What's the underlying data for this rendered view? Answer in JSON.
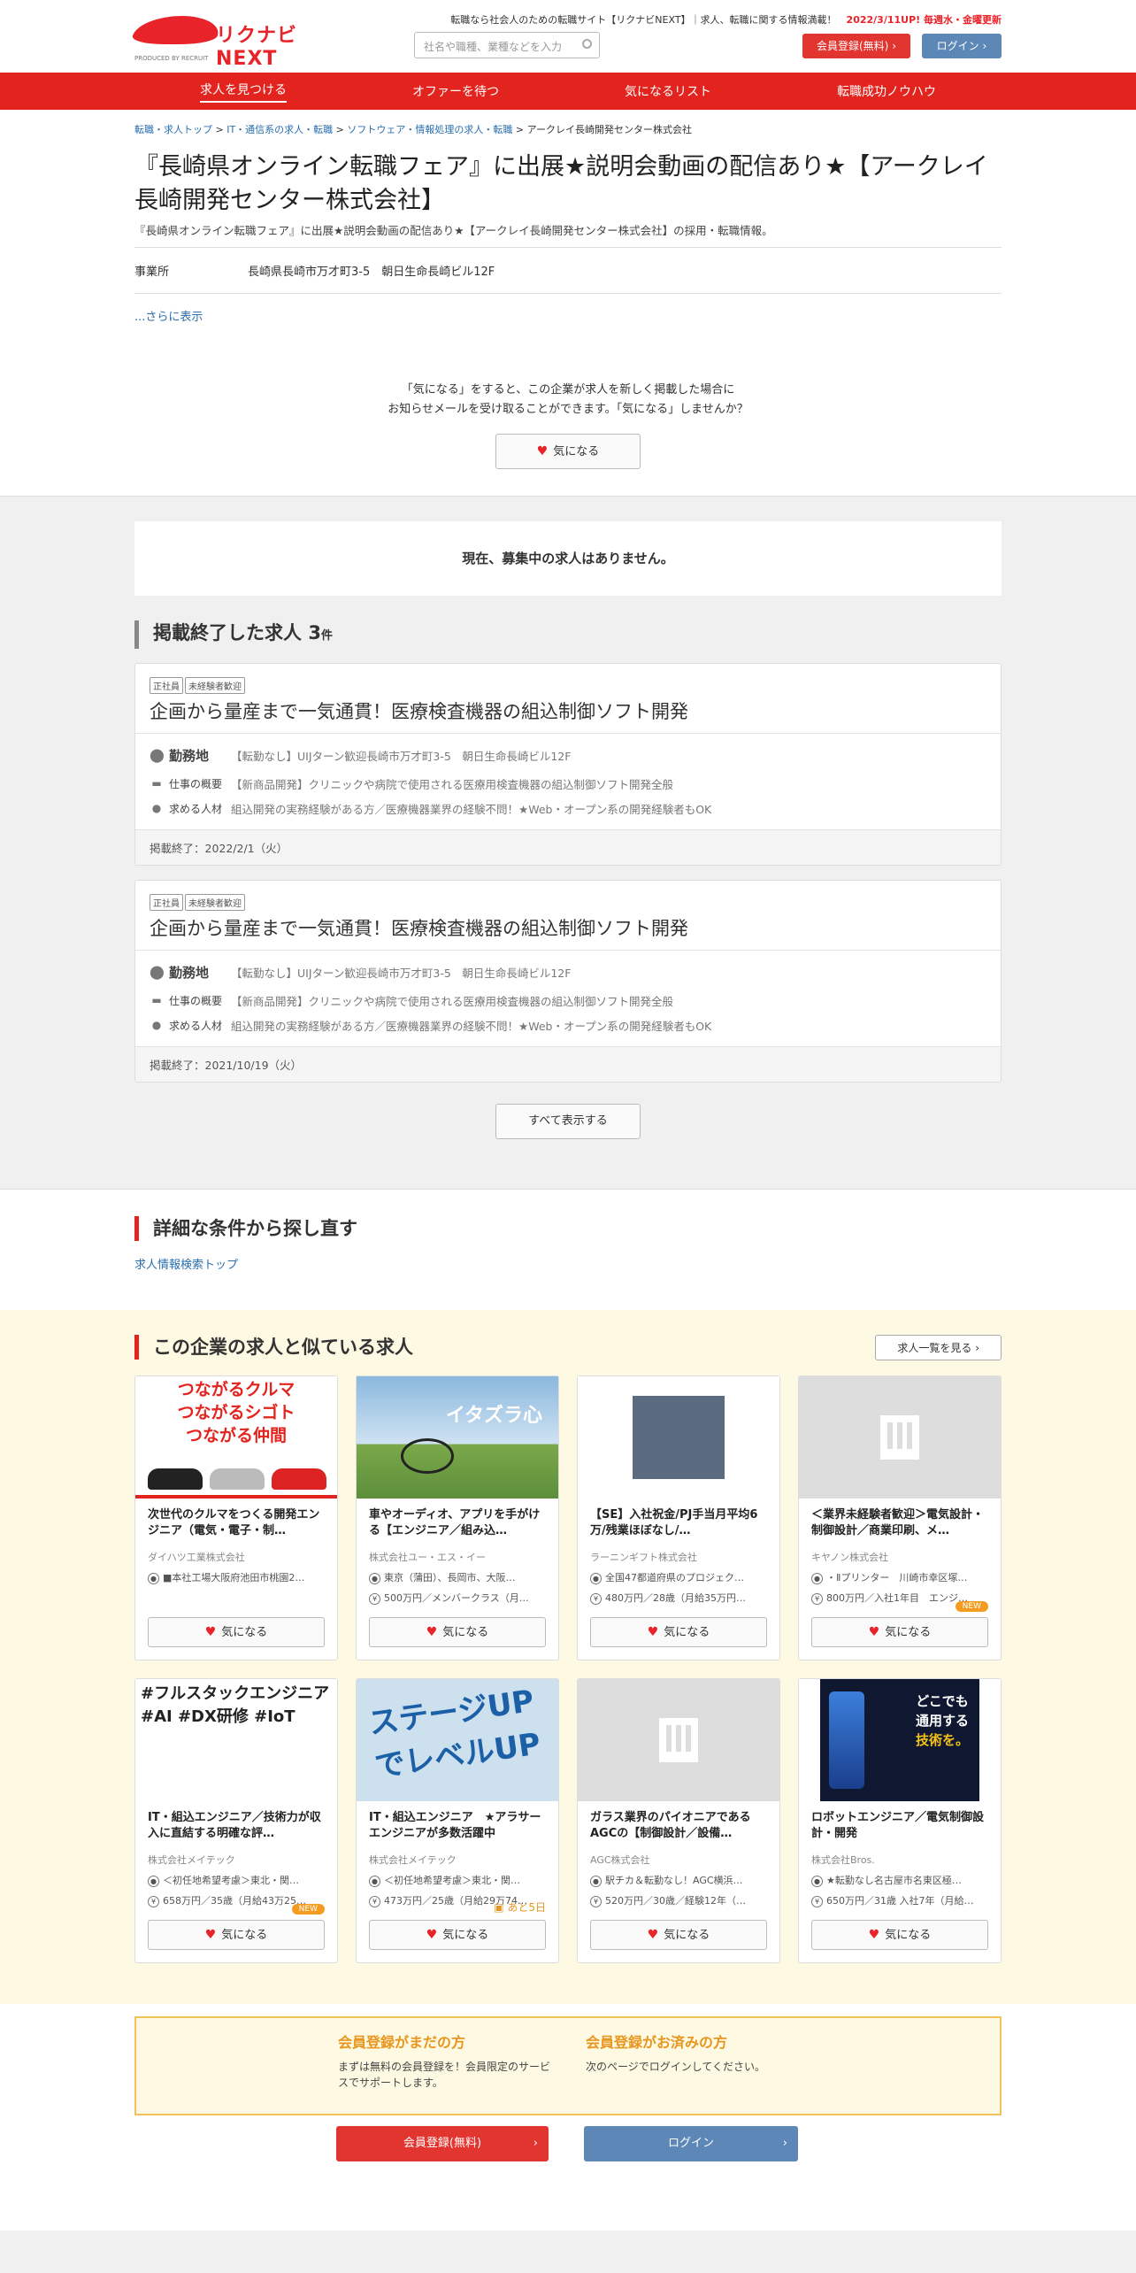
{
  "header": {
    "tagline_prefix": "転職なら社会人のための転職サイト【リクナビNEXT】｜求人、転職に関する情報満載！",
    "tagline_update": "2022/3/11UP! 毎週水・金曜更新",
    "logo_text": "リクナビNEXT",
    "logo_sub": "PRODUCED BY RECRUIT",
    "search_placeholder": "社名や職種、業種などを入力",
    "register_label": "会員登録(無料)",
    "login_label": "ログイン"
  },
  "nav": [
    "求人を見つける",
    "オファーを待つ",
    "気になるリスト",
    "転職成功ノウハウ"
  ],
  "breadcrumb": [
    "転職・求人トップ",
    "IT・通信系の求人・転職",
    "ソフトウェア・情報処理の求人・転職",
    "アークレイ長崎開発センター株式会社"
  ],
  "page": {
    "title": "『長崎県オンライン転職フェア』に出展★説明会動画の配信あり★【アークレイ長崎開発センター株式会社】",
    "description": "『長崎県オンライン転職フェア』に出展★説明会動画の配信あり★【アークレイ長崎開発センター株式会社】の採用・転職情報。",
    "office_label": "事業所",
    "office_value": "長崎県長崎市万才町3-5　朝日生命長崎ビル12F",
    "more": "...さらに表示",
    "fav_msg_1": "「気になる」をすると、この企業が求人を新しく掲載した場合に",
    "fav_msg_2": "お知らせメールを受け取ることができます。「気になる」しませんか？",
    "fav_button": "気になる"
  },
  "jobs": {
    "none_msg": "現在、募集中の求人はありません。",
    "ended_title": "掲載終了した求人",
    "ended_count": "3",
    "ended_unit": "件",
    "show_all": "すべて表示する",
    "items": [
      {
        "tags": [
          "正社員",
          "未経験者歓迎"
        ],
        "title": "企画から量産まで一気通貫！医療検査機器の組込制御ソフト開発",
        "loc_label": "勤務地",
        "loc": "【転勤なし】UIJターン歓迎長崎市万才町3-5　朝日生命長崎ビル12F",
        "work_label": "仕事の概要",
        "work": "【新商品開発】クリニックや病院で使用される医療用検査機器の組込制御ソフト開発全般",
        "req_label": "求める人材",
        "req": "組込開発の実務経験がある方／医療機器業界の経験不問！★Web・オープン系の開発経験者もOK",
        "end": "掲載終了：2022/2/1（火）"
      },
      {
        "tags": [
          "正社員",
          "未経験者歓迎"
        ],
        "title": "企画から量産まで一気通貫！医療検査機器の組込制御ソフト開発",
        "loc_label": "勤務地",
        "loc": "【転勤なし】UIJターン歓迎長崎市万才町3-5　朝日生命長崎ビル12F",
        "work_label": "仕事の概要",
        "work": "【新商品開発】クリニックや病院で使用される医療用検査機器の組込制御ソフト開発全般",
        "req_label": "求める人材",
        "req": "組込開発の実務経験がある方／医療機器業界の経験不問！★Web・オープン系の開発経験者もOK",
        "end": "掲載終了：2021/10/19（火）"
      }
    ]
  },
  "detail": {
    "title": "詳細な条件から探し直す",
    "link": "求人情報検索トップ"
  },
  "similar": {
    "title": "この企業の求人と似ている求人",
    "view_all": "求人一覧を見る",
    "fav": "気になる",
    "img1": "つながるクルマ\nつながるシゴト\nつながる仲間",
    "img2": "イタズラ心",
    "img5": "#フルスタックエンジニア #AI #DX研修 #IoT",
    "img6": "ステージUP でレベルUP",
    "img8a": "どこでも",
    "img8b": "通用する",
    "img8c": "技術を。",
    "items": [
      {
        "title": "次世代のクルマをつくる開発エンジニア（電気・電子・制…",
        "company": "ダイハツ工業株式会社",
        "l1": "■本社工場大阪府池田市桃園2…",
        "l2": "",
        "badge": ""
      },
      {
        "title": "車やオーディオ、アプリを手がける【エンジニア／組み込…",
        "company": "株式会社ユー・エス・イー",
        "l1": "東京（蒲田）、長岡市、大阪…",
        "l2": "500万円／メンバークラス（月…",
        "badge": ""
      },
      {
        "title": "【SE】入社祝金/PJ手当月平均6万/残業ほぼなし/…",
        "company": "ラーニンギフト株式会社",
        "l1": "全国47都道府県のプロジェク…",
        "l2": "480万円／28歳（月給35万円…",
        "badge": ""
      },
      {
        "title": "＜業界未経験者歓迎＞電気設計・制御設計／商業印刷、メ…",
        "company": "キヤノン株式会社",
        "l1": "・Ⅱプリンター　川崎市幸区塚…",
        "l2": "800万円／入社1年目　エンジ…",
        "badge": "NEW"
      },
      {
        "title": "IT・組込エンジニア／技術力が収入に直結する明確な評…",
        "company": "株式会社メイテック",
        "l1": "＜初任地希望考慮＞東北・関…",
        "l2": "658万円／35歳（月給43万25…",
        "badge": "NEW"
      },
      {
        "title": "IT・組込エンジニア　★アラサーエンジニアが多数活躍中",
        "company": "株式会社メイテック",
        "l1": "＜初任地希望考慮＞東北・関…",
        "l2": "473万円／25歳（月給29万74…",
        "badge": "あと5日"
      },
      {
        "title": "ガラス業界のパイオニアであるAGCの【制御設計／設備…",
        "company": "AGC株式会社",
        "l1": "駅チカ＆転勤なし！AGC横浜…",
        "l2": "520万円／30歳／経験12年（…",
        "badge": ""
      },
      {
        "title": "ロボットエンジニア／電気制御設計・開発",
        "company": "株式会社Bros.",
        "l1": "★転勤なし名古屋市名東区極…",
        "l2": "650万円／31歳 入社7年（月給…",
        "badge": ""
      }
    ]
  },
  "member": {
    "h1": "会員登録がまだの方",
    "p1": "まずは無料の会員登録を！会員限定のサービスでサポートします。",
    "b1": "会員登録(無料)",
    "h2": "会員登録がお済みの方",
    "p2": "次のページでログインしてください。",
    "b2": "ログイン"
  },
  "colors": {
    "brand": "#e3241e",
    "accent": "#e8961f",
    "link": "#2a6fb0"
  }
}
